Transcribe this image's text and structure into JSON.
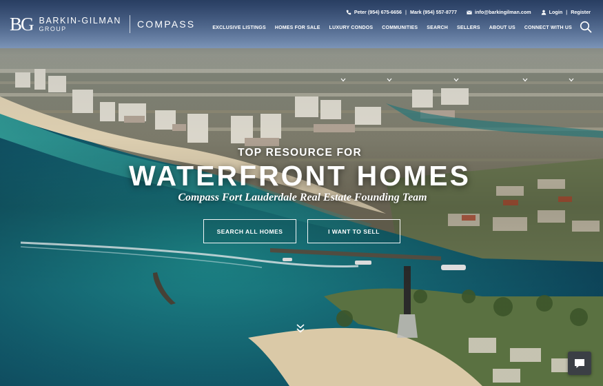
{
  "brand": {
    "monogram": "BG",
    "name": "BARKIN-GILMAN",
    "group": "GROUP",
    "partner": "COMPASS"
  },
  "contact": {
    "phone_1": "Peter (954) 675-6656",
    "separator": "|",
    "phone_2": "Mark (954) 557-8777",
    "email": "info@barkingilman.com",
    "login": "Login",
    "account_separator": "|",
    "register": "Register"
  },
  "nav": {
    "items": [
      "EXCLUSIVE LISTINGS",
      "HOMES FOR SALE",
      "LUXURY CONDOS",
      "COMMUNITIES",
      "SEARCH",
      "SELLERS",
      "ABOUT US",
      "CONNECT WITH US"
    ]
  },
  "hero": {
    "eyebrow": "TOP RESOURCE FOR",
    "headline": "WATERFRONT HOMES",
    "subheadline": "Compass Fort Lauderdale Real Estate Founding Team",
    "cta_search": "SEARCH ALL HOMES",
    "cta_sell": "I WANT TO SELL"
  },
  "icons": {
    "phone": "phone-icon",
    "email": "envelope-icon",
    "user": "user-icon",
    "search": "search-icon",
    "dropdown": "chevron-down-icon",
    "scroll": "double-chevron-down-icon",
    "chat": "chat-bubble-icon"
  },
  "colors": {
    "text": "#ffffff",
    "chat_button": "#3b3f45",
    "ocean": "#13606f",
    "sky": "#6f93c9"
  }
}
